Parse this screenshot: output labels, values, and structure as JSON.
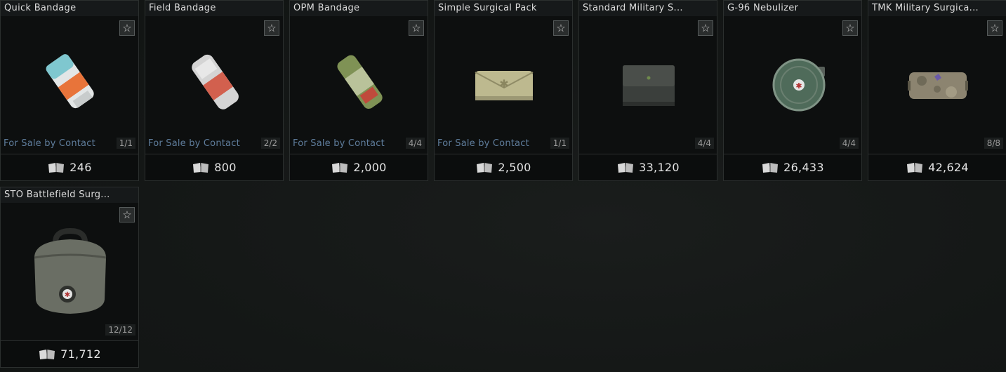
{
  "items": [
    {
      "name": "Quick Bandage",
      "sale": "For Sale by Contact",
      "stock": "1/1",
      "price": "246",
      "icon": "bandage-icon",
      "color": "#d9dede"
    },
    {
      "name": "Field Bandage",
      "sale": "For Sale by Contact",
      "stock": "2/2",
      "price": "800",
      "icon": "bandage-icon",
      "color": "#cfcfcf"
    },
    {
      "name": "OPM Bandage",
      "sale": "For Sale by Contact",
      "stock": "4/4",
      "price": "2,000",
      "icon": "bandage-icon",
      "color": "#8a9a5f"
    },
    {
      "name": "Simple Surgical Pack",
      "sale": "For Sale by Contact",
      "stock": "1/1",
      "price": "2,500",
      "icon": "surgical-pouch-icon",
      "color": "#bdb98f"
    },
    {
      "name": "Standard Military S...",
      "sale": "",
      "stock": "4/4",
      "price": "33,120",
      "icon": "military-pouch-icon",
      "color": "#3e423f"
    },
    {
      "name": "G-96 Nebulizer",
      "sale": "",
      "stock": "4/4",
      "price": "26,433",
      "icon": "nebulizer-icon",
      "color": "#4f6b5a"
    },
    {
      "name": "TMK Military Surgica...",
      "sale": "",
      "stock": "8/8",
      "price": "42,624",
      "icon": "camo-case-icon",
      "color": "#8c8470"
    },
    {
      "name": "STO Battlefield Surg...",
      "sale": "",
      "stock": "12/12",
      "price": "71,712",
      "icon": "medical-bag-icon",
      "color": "#6a6e64"
    }
  ],
  "ui": {
    "favorite_glyph": "☆",
    "currency_icon": "currency-book-icon"
  }
}
